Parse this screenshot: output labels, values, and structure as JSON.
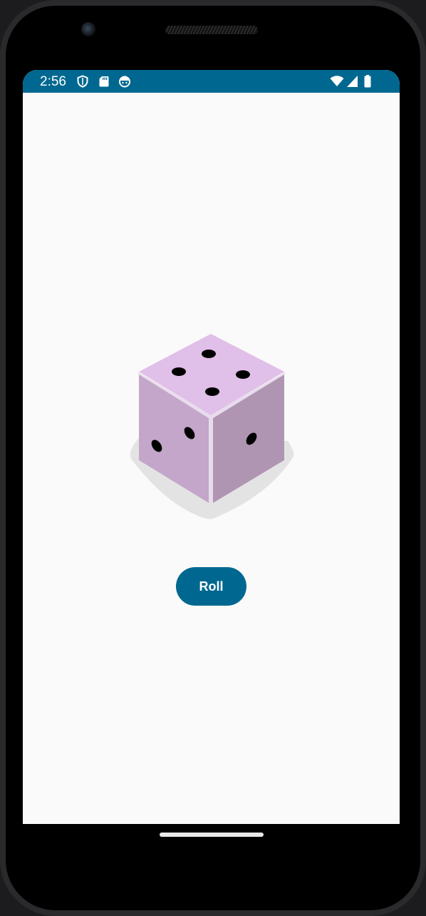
{
  "status_bar": {
    "time": "2:56",
    "background_color": "#006890",
    "left_icons": [
      "shield-icon",
      "sd-card-icon",
      "android-face-icon"
    ],
    "right_icons": [
      "wifi-icon",
      "cell-signal-icon",
      "battery-icon"
    ]
  },
  "main": {
    "dice": {
      "icon": "dice-icon",
      "value": 4,
      "top_color": "#e0bfe8",
      "left_color": "#c3a6c9",
      "right_color": "#b095b3"
    },
    "roll_button": {
      "label": "Roll",
      "color": "#006890"
    }
  }
}
